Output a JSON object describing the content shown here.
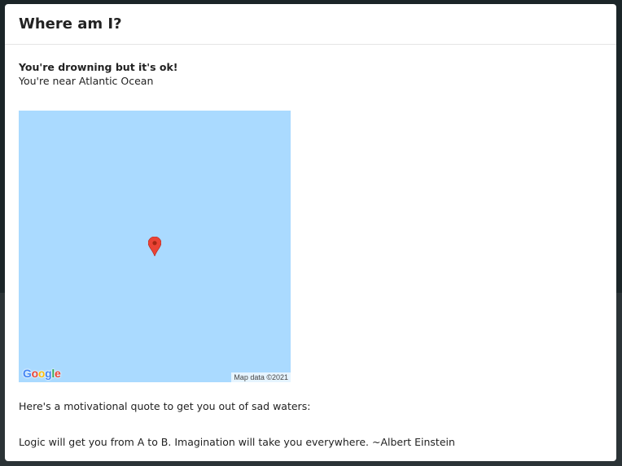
{
  "modal": {
    "title": "Where am I?"
  },
  "status": {
    "heading": "You're drowning but it's ok!",
    "location": "You're near Atlantic Ocean"
  },
  "map": {
    "background_color": "#aadaff",
    "pin_color": "#ea4335",
    "pin_icon": "map-pin-icon",
    "logo": {
      "letters": [
        "G",
        "o",
        "o",
        "g",
        "l",
        "e"
      ],
      "colors": [
        "#4285f4",
        "#ea4335",
        "#fbbc05",
        "#4285f4",
        "#34a853",
        "#ea4335"
      ]
    },
    "attribution": "Map data ©2021"
  },
  "quote": {
    "intro": "Here's a motivational quote to get you out of sad waters:",
    "text": "Logic will get you from A to B. Imagination will take you everywhere. ~Albert Einstein"
  }
}
